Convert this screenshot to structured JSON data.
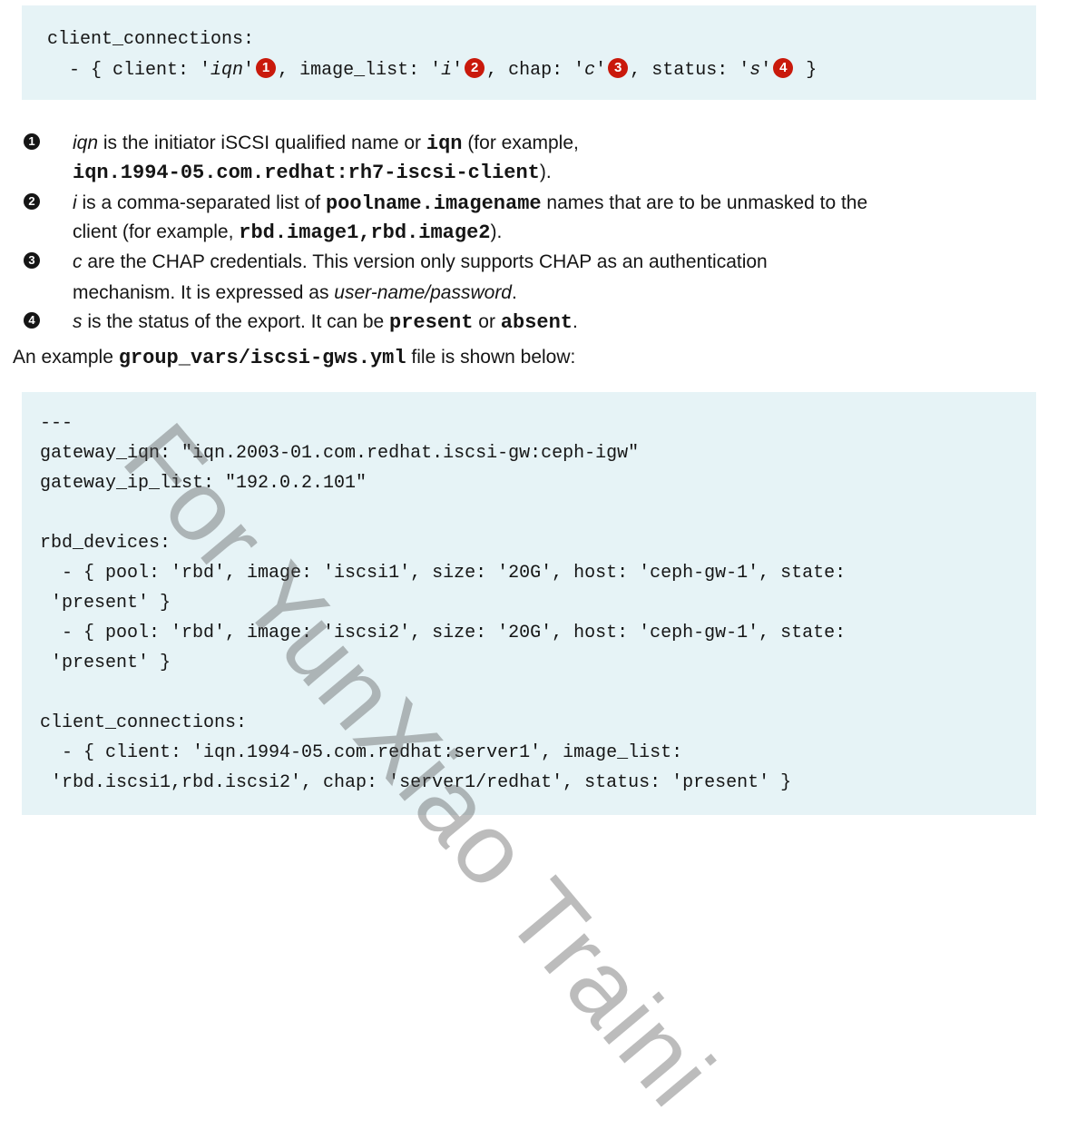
{
  "code_block_1": {
    "line_1": "client_connections:",
    "line_2": {
      "p1": "  - { client: '",
      "iqn": "iqn",
      "p2": "'",
      "c1": "1",
      "p3": ", image_list: '",
      "i": "i",
      "p4": "'",
      "c2": "2",
      "p5": ", chap: '",
      "c": "c",
      "p6": "'",
      "c3": "3",
      "p7": ", status: '",
      "s": "s",
      "p8": "'",
      "c4": "4",
      "p9": " }"
    }
  },
  "callouts": [
    {
      "marker": "1",
      "line1": {
        "a": "iqn",
        "b": " is the initiator iSCSI qualified name or ",
        "c": "iqn",
        "d": " (for example,"
      },
      "line2": {
        "a": "iqn.1994-05.com.redhat:rh7-iscsi-client",
        "b": ")."
      }
    },
    {
      "marker": "2",
      "line1": {
        "a": "i",
        "b": " is a comma-separated list of ",
        "c": "poolname.imagename",
        "d": " names that are to be unmasked to the"
      },
      "line2": {
        "a": "client (for example, ",
        "b": "rbd.image1,rbd.image2",
        "c": ")."
      }
    },
    {
      "marker": "3",
      "line1": {
        "a": "c",
        "b": " are the CHAP credentials. This version only supports CHAP as an authentication"
      },
      "line2": {
        "a": "mechanism. It is expressed as ",
        "b": "user-name/password",
        "c": "."
      }
    },
    {
      "marker": "4",
      "line1": {
        "a": "s",
        "b": " is the status of the export. It can be ",
        "c": "present",
        "d": " or ",
        "e": "absent",
        "f": "."
      }
    }
  ],
  "example_intro": {
    "a": "An example ",
    "b": "group_vars/iscsi-gws.yml",
    "c": " file is shown below:"
  },
  "code_block_2": {
    "lines": [
      "---",
      "gateway_iqn: \"iqn.2003-01.com.redhat.iscsi-gw:ceph-igw\"",
      "gateway_ip_list: \"192.0.2.101\"",
      "",
      "rbd_devices:",
      "  - { pool: 'rbd', image: 'iscsi1', size: '20G', host: 'ceph-gw-1', state:",
      " 'present' }",
      "  - { pool: 'rbd', image: 'iscsi2', size: '20G', host: 'ceph-gw-1', state:",
      " 'present' }",
      "",
      "client_connections:",
      "  - { client: 'iqn.1994-05.com.redhat:server1', image_list:",
      " 'rbd.iscsi1,rbd.iscsi2', chap: 'server1/redhat', status: 'present' }"
    ]
  },
  "watermark": "For YunXiao Traini"
}
